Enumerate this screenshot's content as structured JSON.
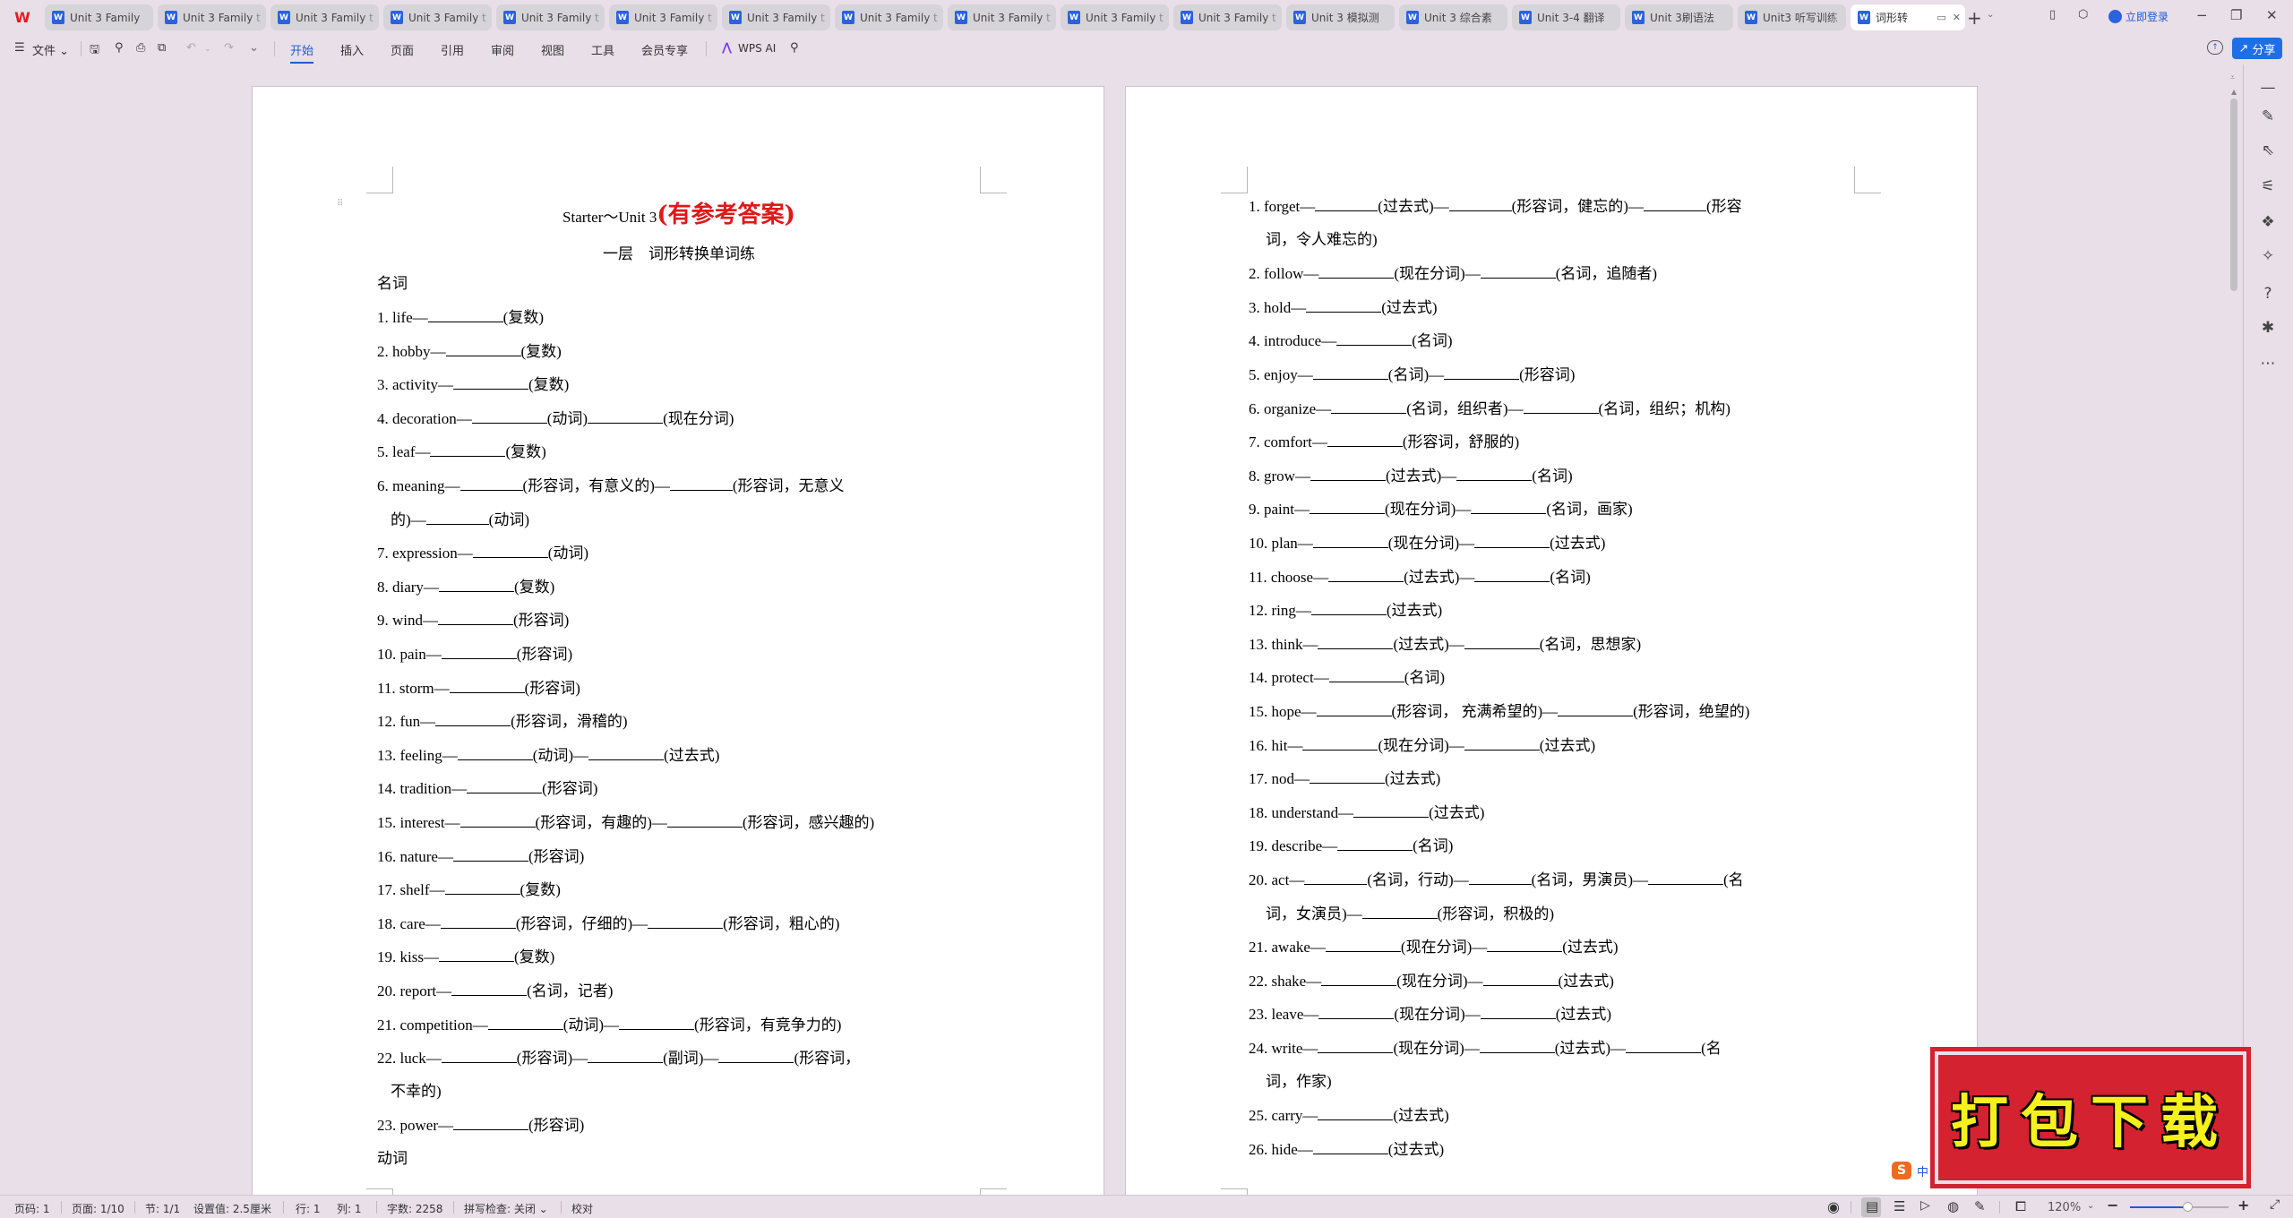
{
  "app": {
    "logo": "W",
    "tabs": [
      {
        "label": "Unit 3  Family",
        "active": false
      },
      {
        "label": "Unit 3 Family t",
        "active": false
      },
      {
        "label": "Unit 3 Family t",
        "active": false
      },
      {
        "label": "Unit 3 Family t",
        "active": false
      },
      {
        "label": "Unit 3 Family t",
        "active": false
      },
      {
        "label": "Unit 3 Family t",
        "active": false
      },
      {
        "label": "Unit 3 Family t",
        "active": false
      },
      {
        "label": "Unit 3 Family t",
        "active": false
      },
      {
        "label": "Unit 3 Family t",
        "active": false
      },
      {
        "label": "Unit 3 Family t",
        "active": false
      },
      {
        "label": "Unit 3 Family t",
        "active": false
      },
      {
        "label": "Unit 3 模拟测",
        "active": false
      },
      {
        "label": "Unit 3 综合素",
        "active": false
      },
      {
        "label": "Unit 3-4 翻译",
        "active": false
      },
      {
        "label": "Unit 3刷语法",
        "active": false
      },
      {
        "label": "Unit3 听写训练",
        "active": false
      },
      {
        "label": "词形转",
        "active": true
      }
    ],
    "new_tab": "+",
    "login_label": "立即登录",
    "window": {
      "minimize": "−",
      "restore": "❐",
      "close": "✕"
    }
  },
  "ribbon": {
    "file_menu": "文件",
    "tabs": [
      "开始",
      "插入",
      "页面",
      "引用",
      "审阅",
      "视图",
      "工具",
      "会员专享"
    ],
    "active_tab": "开始",
    "wps_ai": "WPS AI",
    "share_label": "分享"
  },
  "document": {
    "left_page": {
      "title_en": "Starter～Unit 3",
      "title_note": "(有参考答案)",
      "subtitle": "一层　词形转换单词练",
      "section_nouns": "名词",
      "items": [
        {
          "segs": [
            "1. life—",
            "_",
            "(复数)"
          ]
        },
        {
          "segs": [
            "2. hobby—",
            "_",
            "(复数)"
          ]
        },
        {
          "segs": [
            "3. activity—",
            "_",
            "(复数)"
          ]
        },
        {
          "segs": [
            "4. decoration—",
            "_",
            "(动词)",
            "_",
            "(现在分词)"
          ]
        },
        {
          "segs": [
            "5. leaf—",
            "_",
            "(复数)"
          ]
        },
        {
          "segs": [
            "6. meaning—",
            "_s",
            "(形容词，有意义的)—",
            "_s",
            "(形容词，无意义"
          ],
          "cont": [
            "的)—",
            "_s",
            "(动词)"
          ]
        },
        {
          "segs": [
            "7. expression—",
            "_",
            "(动词)"
          ]
        },
        {
          "segs": [
            "8. diary—",
            "_",
            "(复数)"
          ]
        },
        {
          "segs": [
            "9. wind—",
            "_",
            "(形容词)"
          ]
        },
        {
          "segs": [
            "10. pain—",
            "_",
            "(形容词)"
          ]
        },
        {
          "segs": [
            "11. storm—",
            "_",
            "(形容词)"
          ]
        },
        {
          "segs": [
            "12. fun—",
            "_",
            "(形容词，滑稽的)"
          ]
        },
        {
          "segs": [
            "13. feeling—",
            "_",
            "(动词)—",
            "_",
            "(过去式)"
          ]
        },
        {
          "segs": [
            "14. tradition—",
            "_",
            "(形容词)"
          ]
        },
        {
          "segs": [
            "15. interest—",
            "_",
            "(形容词，有趣的)—",
            "_",
            "(形容词，感兴趣的)"
          ]
        },
        {
          "segs": [
            "16. nature—",
            "_",
            "(形容词)"
          ]
        },
        {
          "segs": [
            "17. shelf—",
            "_",
            "(复数)"
          ]
        },
        {
          "segs": [
            "18. care—",
            "_",
            "(形容词，仔细的)—",
            "_",
            "(形容词，粗心的)"
          ]
        },
        {
          "segs": [
            "19. kiss—",
            "_",
            "(复数)"
          ]
        },
        {
          "segs": [
            "20. report—",
            "_",
            "(名词，记者)"
          ]
        },
        {
          "segs": [
            "21. competition—",
            "_",
            "(动词)—",
            "_",
            "(形容词，有竞争力的)"
          ]
        },
        {
          "segs": [
            "22. luck—",
            "_",
            "(形容词)—",
            "_",
            "(副词)—",
            "_",
            "(形容词，"
          ],
          "cont": [
            "不幸的)"
          ]
        },
        {
          "segs": [
            "23. power—",
            "_",
            "(形容词)"
          ]
        }
      ],
      "section_verbs": "动词"
    },
    "right_page": {
      "items": [
        {
          "segs": [
            "1. forget—",
            "_s",
            "(过去式)—",
            "_s",
            "(形容词，健忘的)—",
            "_s",
            "(形容"
          ],
          "cont": [
            "词，令人难忘的)"
          ]
        },
        {
          "segs": [
            "2. follow—",
            "_",
            "(现在分词)—",
            "_",
            "(名词，追随者)"
          ]
        },
        {
          "segs": [
            "3. hold—",
            "_",
            "(过去式)"
          ]
        },
        {
          "segs": [
            "4. introduce—",
            "_",
            "(名词)"
          ]
        },
        {
          "segs": [
            "5. enjoy—",
            "_",
            "(名词)—",
            "_",
            "(形容词)"
          ]
        },
        {
          "segs": [
            "6. organize—",
            "_",
            "(名词，组织者)—",
            "_",
            "(名词，组织；机构)"
          ]
        },
        {
          "segs": [
            "7. comfort—",
            "_",
            "(形容词，舒服的)"
          ]
        },
        {
          "segs": [
            "8. grow—",
            "_",
            "(过去式)—",
            "_",
            "(名词)"
          ]
        },
        {
          "segs": [
            "9. paint—",
            "_",
            "(现在分词)—",
            "_",
            "(名词，画家)"
          ]
        },
        {
          "segs": [
            "10. plan—",
            "_",
            "(现在分词)—",
            "_",
            "(过去式)"
          ]
        },
        {
          "segs": [
            "11. choose—",
            "_",
            "(过去式)—",
            "_",
            "(名词)"
          ]
        },
        {
          "segs": [
            "12. ring—",
            "_",
            "(过去式)"
          ]
        },
        {
          "segs": [
            "13. think—",
            "_",
            "(过去式)—",
            "_",
            "(名词，思想家)"
          ]
        },
        {
          "segs": [
            "14. protect—",
            "_",
            "(名词)"
          ]
        },
        {
          "segs": [
            "15. hope—",
            "_",
            "(形容词， 充满希望的)—",
            "_",
            "(形容词，绝望的)"
          ]
        },
        {
          "segs": [
            "16. hit—",
            "_",
            "(现在分词)—",
            "_",
            "(过去式)"
          ]
        },
        {
          "segs": [
            "17. nod—",
            "_",
            "(过去式)"
          ]
        },
        {
          "segs": [
            "18. understand—",
            "_",
            "(过去式)"
          ]
        },
        {
          "segs": [
            "19. describe—",
            "_",
            "(名词)"
          ]
        },
        {
          "segs": [
            "20. act—",
            "_s",
            "(名词，行动)—",
            "_s",
            "(名词，男演员)—",
            "_",
            "(名"
          ],
          "cont": [
            "词，女演员)—",
            "_",
            "(形容词，积极的)"
          ]
        },
        {
          "segs": [
            "21. awake—",
            "_",
            "(现在分词)—",
            "_",
            "(过去式)"
          ]
        },
        {
          "segs": [
            "22. shake—",
            "_",
            "(现在分词)—",
            "_",
            "(过去式)"
          ]
        },
        {
          "segs": [
            "23. leave—",
            "_",
            "(现在分词)—",
            "_",
            "(过去式)"
          ]
        },
        {
          "segs": [
            "24. write—",
            "_",
            "(现在分词)—",
            "_",
            "(过去式)—",
            "_",
            "(名"
          ],
          "cont": [
            "词，作家)"
          ]
        },
        {
          "segs": [
            "25. carry—",
            "_",
            "(过去式)"
          ]
        },
        {
          "segs": [
            "26. hide—",
            "_",
            "(过去式)"
          ]
        }
      ]
    }
  },
  "overlay": {
    "stamp_text": "打包下载",
    "ime_logo": "S",
    "ime_mode": "中"
  },
  "statusbar": {
    "page_code": "页码: 1",
    "page": "页面: 1/10",
    "section": "节: 1/1",
    "setting": "设置值: 2.5厘米",
    "row": "行: 1",
    "col": "列: 1",
    "word_count": "字数: 2258",
    "spell_check": "拼写检查: 关闭",
    "proofread": "校对",
    "zoom_level": "120%",
    "zoom_fraction": 0.58
  },
  "colors": {
    "accent": "#1e5bd8",
    "title_red": "#e01818",
    "stamp_red": "#d42230",
    "stamp_yellow": "#f6f01c"
  }
}
